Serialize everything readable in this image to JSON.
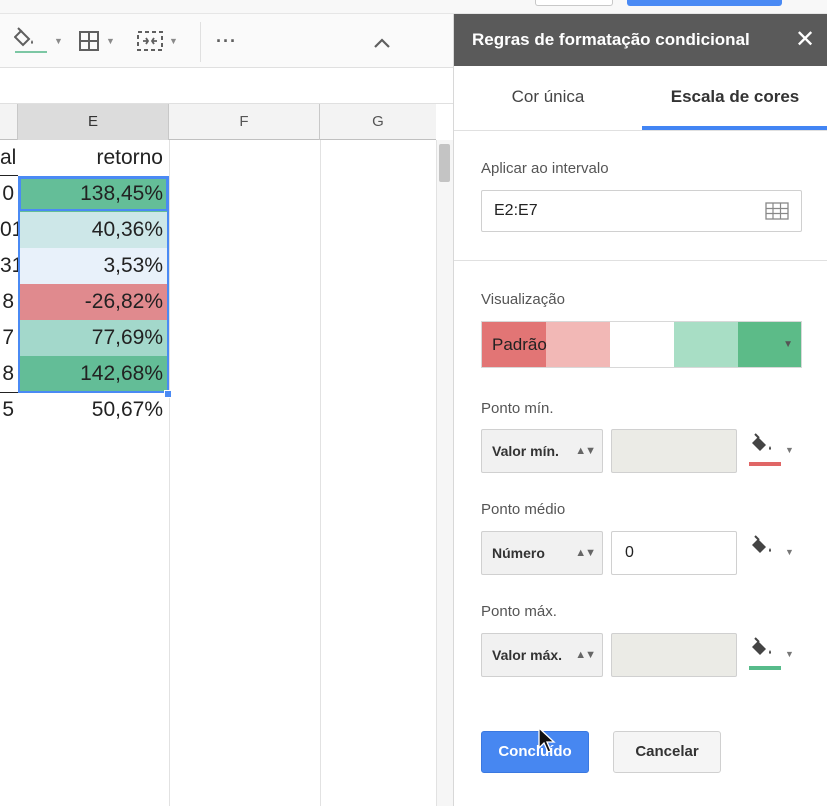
{
  "toolbar": {
    "icons": [
      "paint-bucket-icon",
      "borders-icon",
      "merge-cells-icon",
      "more-icon",
      "collapse-icon"
    ],
    "more_label": "···",
    "collapse_label": "^"
  },
  "sheet": {
    "columns": [
      "E",
      "F",
      "G"
    ],
    "rows": [
      {
        "d": "al",
        "e": "retorno",
        "fill": "#ffffff"
      },
      {
        "d": "0",
        "e": "138,45%",
        "fill": "#64be98"
      },
      {
        "d": "01",
        "e": "40,36%",
        "fill": "#cde7e8"
      },
      {
        "d": "31",
        "e": "3,53%",
        "fill": "#e8f1fa"
      },
      {
        "d": "8",
        "e": "-26,82%",
        "fill": "#e08a8e"
      },
      {
        "d": "7",
        "e": "77,69%",
        "fill": "#a3d8cb"
      },
      {
        "d": "8",
        "e": "142,68%",
        "fill": "#63bd97"
      },
      {
        "d": "5",
        "e": "50,67%",
        "fill": "#ffffff"
      }
    ]
  },
  "panel": {
    "title": "Regras de formatação condicional",
    "close_label": "✕",
    "tabs": [
      "Cor única",
      "Escala de cores"
    ],
    "active_tab": "Escala de cores",
    "apply_range_label": "Aplicar ao intervalo",
    "apply_range_value": "E2:E7",
    "preview_label": "Visualização",
    "preview_name": "Padrão",
    "preview_colors": [
      "#e27575",
      "#f2b8b6",
      "#ffffff",
      "#a8dec5",
      "#5cbb88"
    ],
    "min_point": {
      "label": "Ponto mín.",
      "type": "Valor mín.",
      "value": "",
      "color": "#e06666"
    },
    "mid_point": {
      "label": "Ponto médio",
      "type": "Número",
      "value": "0"
    },
    "max_point": {
      "label": "Ponto máx.",
      "type": "Valor máx.",
      "value": "",
      "color": "#57bb8a"
    },
    "done_label": "Concluído",
    "cancel_label": "Cancelar"
  }
}
